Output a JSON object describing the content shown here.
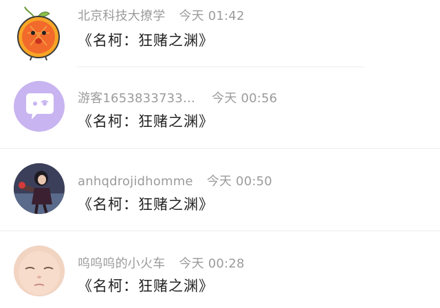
{
  "comments": [
    {
      "username": "北京科技大撩学",
      "time": "今天 01:42",
      "text": "《名柯：狂赌之渊》",
      "avatar_icon": "orange-fruit-avatar-icon"
    },
    {
      "username": "游客1653833733…",
      "time": "今天 00:56",
      "text": "《名柯：狂赌之渊》",
      "avatar_icon": "default-guest-chat-bubble-avatar-icon"
    },
    {
      "username": "anhqdrojidhomme",
      "time": "今天 00:50",
      "text": "《名柯：狂赌之渊》",
      "avatar_icon": "game-character-avatar-icon"
    },
    {
      "username": "呜呜呜的小火车",
      "time": "今天 00:28",
      "text": "《名柯：狂赌之渊》",
      "avatar_icon": "baby-face-avatar-icon"
    }
  ]
}
